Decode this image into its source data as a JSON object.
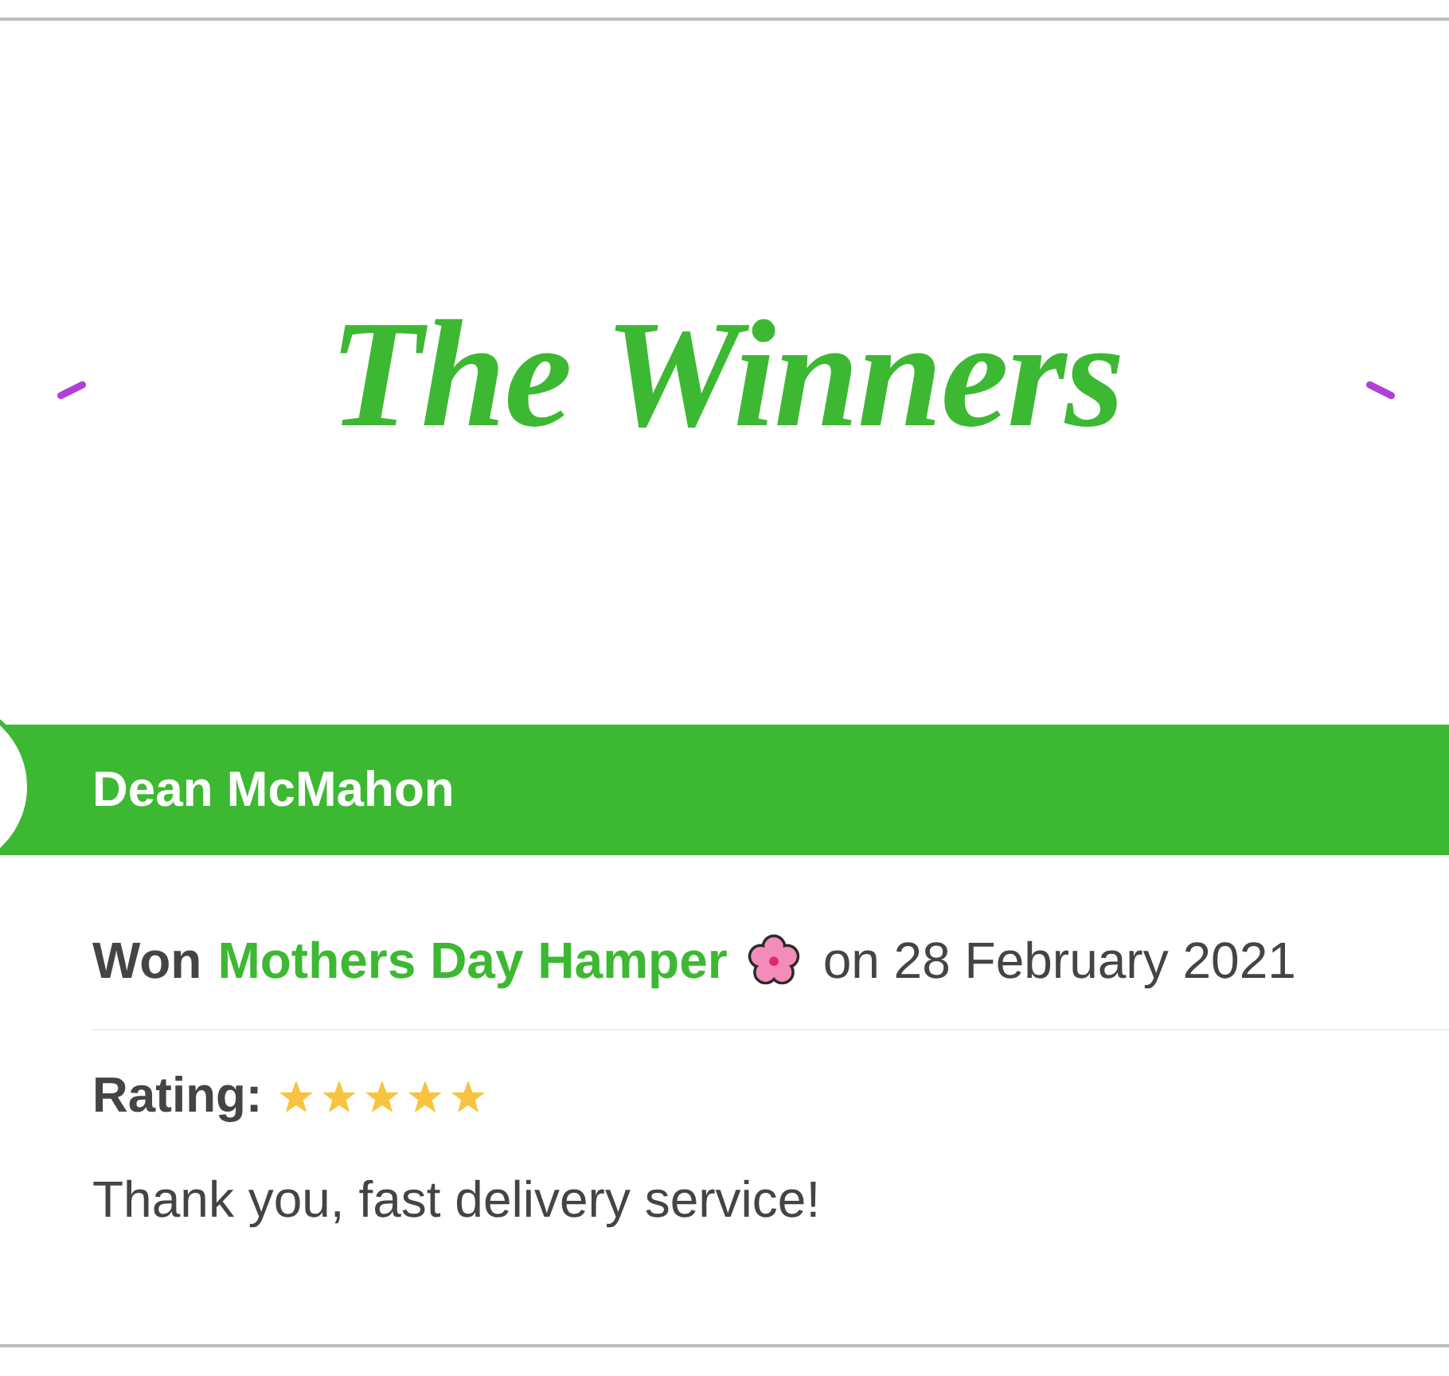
{
  "heading": {
    "title": "The Winners"
  },
  "winner": {
    "name": "Dean McMahon",
    "won_label": "Won",
    "prize": "Mothers Day Hamper",
    "date_text": "on 28 February 2021",
    "rating_label": "Rating:",
    "stars": 5,
    "comment": "Thank you, fast delivery service!"
  }
}
